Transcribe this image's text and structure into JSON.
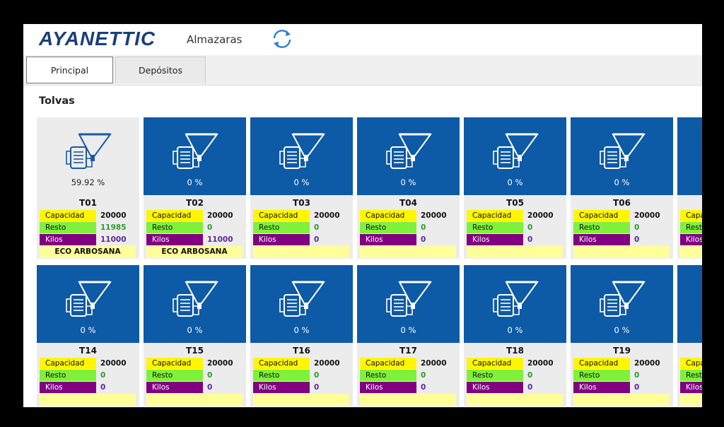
{
  "header": {
    "logo": "AYANETTIC",
    "title": "Almazaras",
    "refresh_icon": "refresh-icon"
  },
  "tabs": [
    {
      "label": "Principal",
      "active": true
    },
    {
      "label": "Depósitos",
      "active": false
    }
  ],
  "section_title": "Tolvas",
  "labels": {
    "capacidad": "Capacidad",
    "resto": "Resto",
    "kilos": "Kilos"
  },
  "colors": {
    "tile_blue": "#0d5aa6",
    "capacidad_yellow": "#fff600",
    "resto_green": "#7ff13a",
    "kilos_purple": "#800080",
    "owner_bg": "#ffff99"
  },
  "tolvas": [
    {
      "code": "T01",
      "percent": "59.92 %",
      "fill": 0.5992,
      "capacidad": "20000",
      "resto": "11985",
      "kilos": "11000",
      "owner": "ECO ARBOSANA"
    },
    {
      "code": "T02",
      "percent": "0 %",
      "fill": 0,
      "capacidad": "20000",
      "resto": "0",
      "kilos": "11000",
      "owner": "ECO ARBOSANA"
    },
    {
      "code": "T03",
      "percent": "0 %",
      "fill": 0,
      "capacidad": "20000",
      "resto": "0",
      "kilos": "0",
      "owner": ""
    },
    {
      "code": "T04",
      "percent": "0 %",
      "fill": 0,
      "capacidad": "20000",
      "resto": "0",
      "kilos": "0",
      "owner": ""
    },
    {
      "code": "T05",
      "percent": "0 %",
      "fill": 0,
      "capacidad": "20000",
      "resto": "0",
      "kilos": "0",
      "owner": ""
    },
    {
      "code": "T06",
      "percent": "0 %",
      "fill": 0,
      "capacidad": "20000",
      "resto": "0",
      "kilos": "0",
      "owner": ""
    },
    {
      "code": "T14",
      "percent": "0 %",
      "fill": 0,
      "capacidad": "20000",
      "resto": "0",
      "kilos": "0",
      "owner": ""
    },
    {
      "code": "T15",
      "percent": "0 %",
      "fill": 0,
      "capacidad": "20000",
      "resto": "0",
      "kilos": "0",
      "owner": ""
    },
    {
      "code": "T16",
      "percent": "0 %",
      "fill": 0,
      "capacidad": "20000",
      "resto": "0",
      "kilos": "0",
      "owner": ""
    },
    {
      "code": "T17",
      "percent": "0 %",
      "fill": 0,
      "capacidad": "20000",
      "resto": "0",
      "kilos": "0",
      "owner": ""
    },
    {
      "code": "T18",
      "percent": "0 %",
      "fill": 0,
      "capacidad": "20000",
      "resto": "0",
      "kilos": "0",
      "owner": ""
    },
    {
      "code": "T19",
      "percent": "0 %",
      "fill": 0,
      "capacidad": "20000",
      "resto": "0",
      "kilos": "0",
      "owner": ""
    }
  ]
}
